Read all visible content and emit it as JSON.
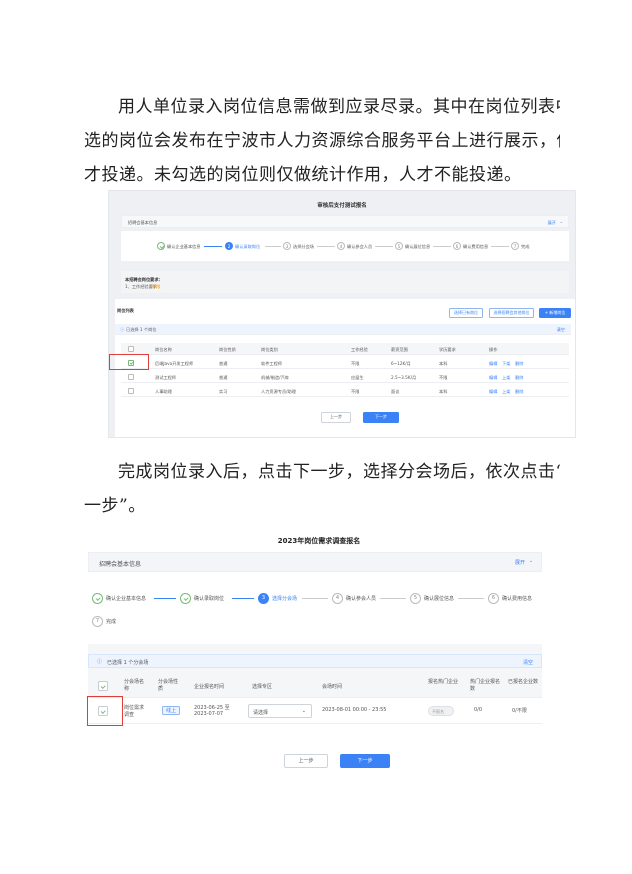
{
  "paragraph1": {
    "lines": [
      "用人单位录入岗位信息需做到应录尽录。其中在岗位列表中勾",
      "选的岗位会发布在宁波市人力资源综合服务平台上进行展示，供人",
      "才投递。未勾选的岗位则仅做统计作用，人才不能投递。"
    ]
  },
  "shot1": {
    "title": "审核后支付测试报名",
    "section_header": "招聘会基本信息",
    "expand": "展开",
    "steps": [
      "确认企业基本信息",
      "确认录取岗位",
      "选择分会场",
      "确认参会人员",
      "确认展位信息",
      "确认费用信息",
      "完成"
    ],
    "step_numbers": [
      "2",
      "3",
      "4",
      "5",
      "6",
      "7"
    ],
    "notice_title": "本招聘会岗位要求：",
    "notice_text": "1、工作经验要求",
    "notice_highlight": "不限",
    "list_title": "岗位列表",
    "btn_select_recent": "选择已有岗位",
    "btn_select_other": "选择招聘会其他岗位",
    "btn_add": "+ 新增岗位",
    "selected_info": "已选择 1 个岗位",
    "clear": "清空",
    "columns": [
      "岗位名称",
      "岗位性质",
      "岗位类别",
      "工作经验",
      "薪资范围",
      "学历要求",
      "操作"
    ],
    "rows": [
      {
        "name": "后端Java开发工程师",
        "nature": "普通",
        "category": "软件工程师",
        "exp": "不限",
        "salary": "6~12K/月",
        "edu": "本科",
        "ops": [
          "编辑",
          "下架",
          "删除"
        ]
      },
      {
        "name": "测试工程师",
        "nature": "普通",
        "category": "机械/制造/汽车",
        "exp": "应届生",
        "salary": "2.5~3.5K/月",
        "edu": "不限",
        "ops": [
          "编辑",
          "上架",
          "删除"
        ]
      },
      {
        "name": "人事助理",
        "nature": "实习",
        "category": "人力资源专员/助理",
        "exp": "不限",
        "salary": "面议",
        "edu": "本科",
        "ops": [
          "编辑",
          "上架",
          "删除"
        ]
      }
    ],
    "prev": "上一步",
    "next": "下一步"
  },
  "paragraph2": {
    "lines": [
      "完成岗位录入后，点击下一步，选择分会场后，依次点击“下",
      "一步”。"
    ]
  },
  "shot2": {
    "title": "2023年岗位需求调查报名",
    "section_header": "招聘会基本信息",
    "expand": "展开",
    "steps": [
      "确认企业基本信息",
      "确认录取岗位",
      "选择分会场",
      "确认参会人员",
      "确认展位信息",
      "确认费用信息",
      "完成"
    ],
    "step_numbers": [
      "3",
      "4",
      "5",
      "6",
      "7"
    ],
    "selected_info": "已选择 1 个分会场",
    "clear": "清空",
    "columns": [
      "分会场名称",
      "分会场性质",
      "企业报名时间",
      "选择专区",
      "会场时间",
      "报名热门企业",
      "热门企业报名数",
      "已报名企业数"
    ],
    "row": {
      "name": "岗位需求调查",
      "nature": "线上",
      "reg_time": "2023-06-25 至 2023-07-07",
      "zone_placeholder": "请选择",
      "venue_time": "2023-08-01 00:00 - 23:55",
      "hot_toggle": "不报名",
      "hot_count": "0/0",
      "registered": "0/不限"
    },
    "prev": "上一步",
    "next": "下一步"
  },
  "colors": {
    "accent": "#3b82f6",
    "highlight": "#e23b3b",
    "done": "#7ab87a"
  }
}
